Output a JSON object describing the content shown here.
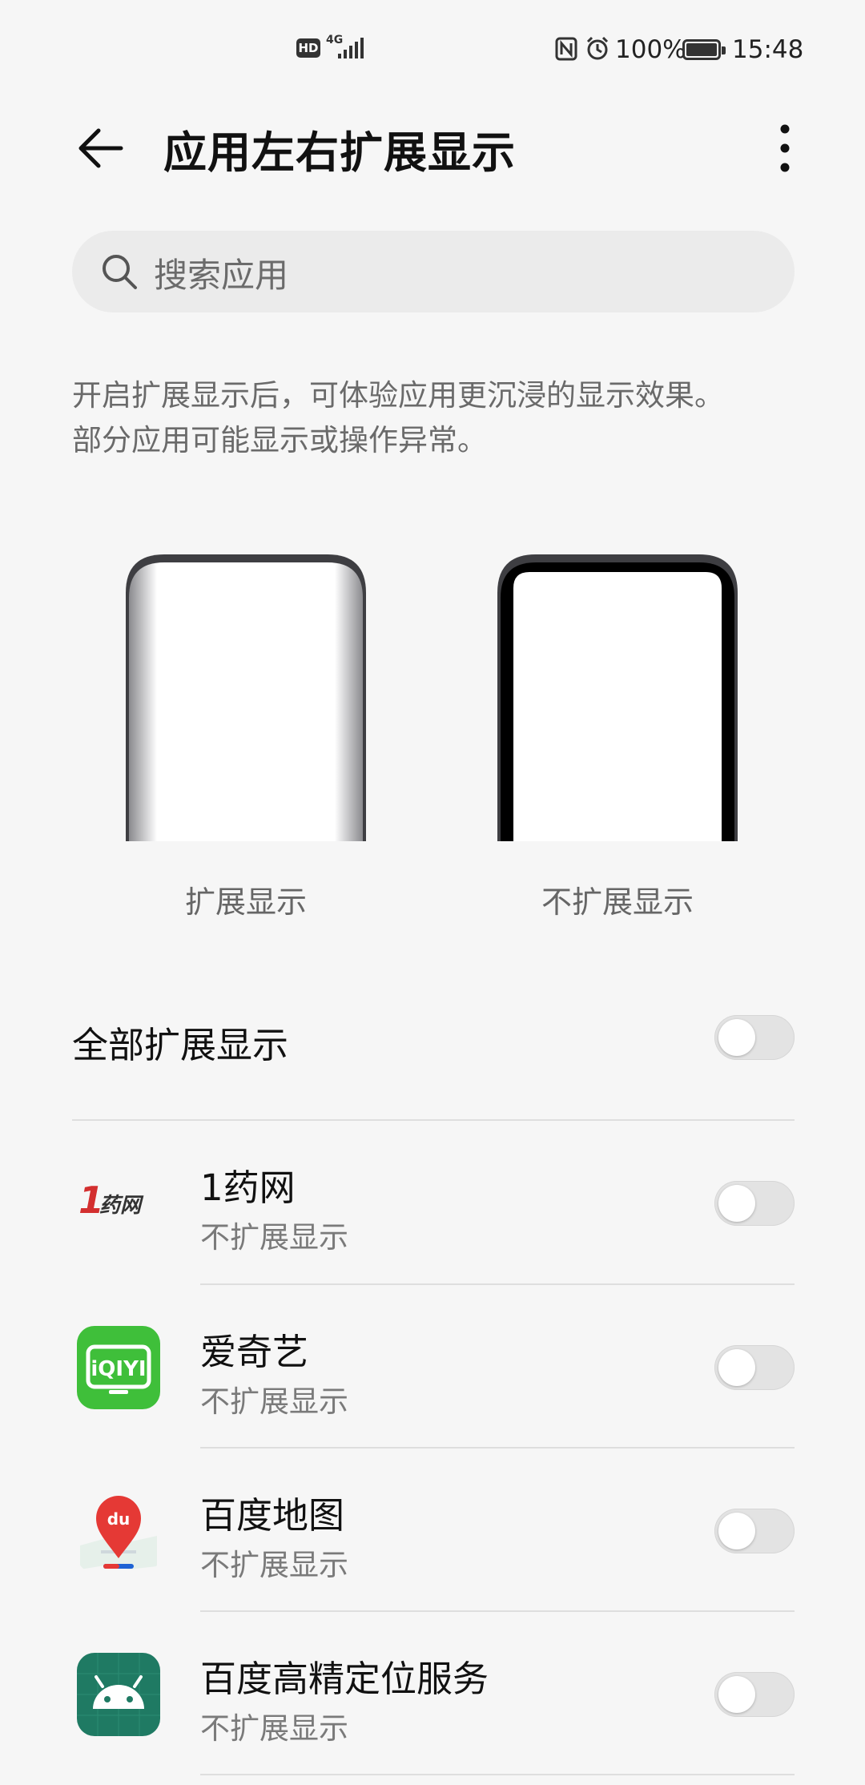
{
  "status_bar": {
    "network_hd": "HD",
    "network_type": "4G",
    "battery_percent": "100%",
    "time": "15:48",
    "icons": [
      "hd-icon",
      "signal-icon",
      "nfc-icon",
      "alarm-icon",
      "battery-icon"
    ]
  },
  "header": {
    "title": "应用左右扩展显示",
    "back_icon": "back-arrow-icon",
    "more_icon": "more-vertical-icon"
  },
  "search": {
    "placeholder": "搜索应用",
    "icon": "search-icon"
  },
  "description": {
    "line1": "开启扩展显示后，可体验应用更沉浸的显示效果。",
    "line2": "部分应用可能显示或操作异常。"
  },
  "illustrations": {
    "expanded_label": "扩展显示",
    "not_expanded_label": "不扩展显示"
  },
  "all_toggle": {
    "label": "全部扩展显示",
    "enabled": false
  },
  "apps": [
    {
      "name": "1药网",
      "status": "不扩展显示",
      "icon": "1yaowang-logo-icon",
      "enabled": false
    },
    {
      "name": "爱奇艺",
      "status": "不扩展显示",
      "icon": "iqiyi-logo-icon",
      "enabled": false
    },
    {
      "name": "百度地图",
      "status": "不扩展显示",
      "icon": "baidu-map-icon",
      "enabled": false
    },
    {
      "name": "百度高精定位服务",
      "status": "不扩展显示",
      "icon": "android-icon",
      "enabled": false
    }
  ],
  "colors": {
    "background": "#f6f6f6",
    "iqiyi_green": "#3fbf3a",
    "android_teal": "#1f7a63",
    "baidu_red": "#e53935",
    "yaowang_red": "#d32f2f"
  }
}
